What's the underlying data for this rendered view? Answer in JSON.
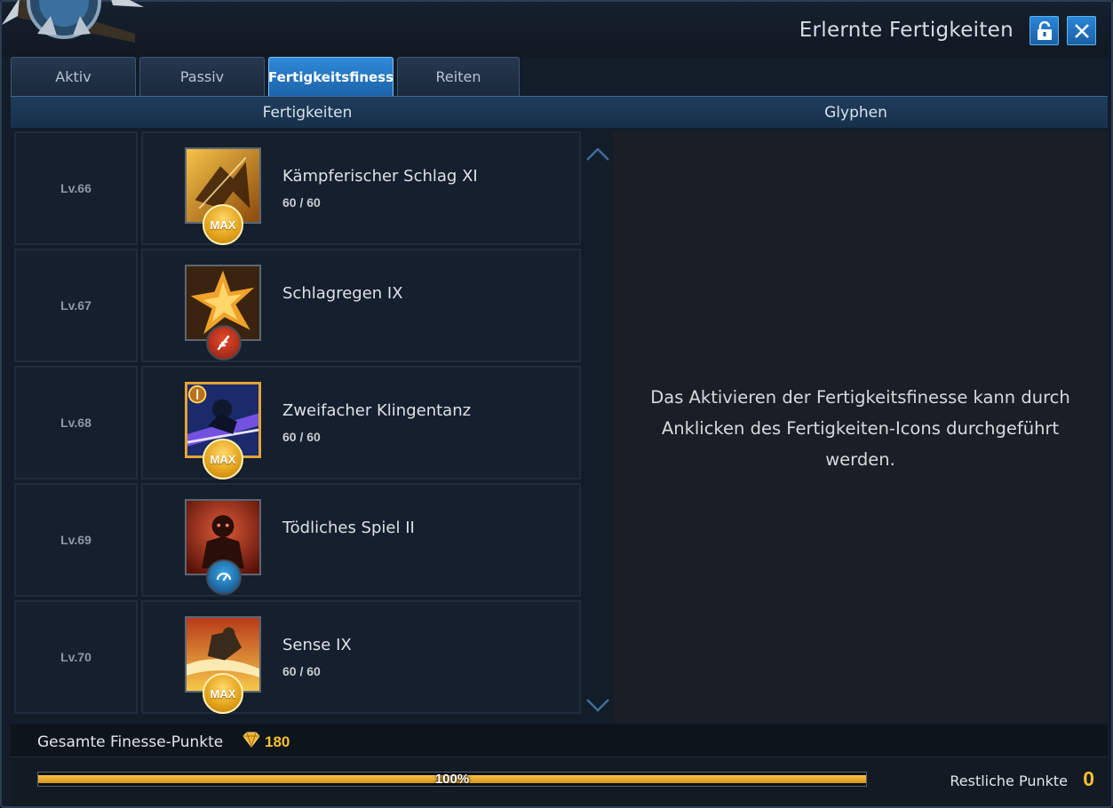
{
  "window": {
    "title": "Erlernte Fertigkeiten",
    "lock_icon": "lock-icon",
    "close_icon": "close-icon"
  },
  "tabs": [
    {
      "label": "Aktiv",
      "active": false
    },
    {
      "label": "Passiv",
      "active": false
    },
    {
      "label": "Fertigkeitsfiness",
      "active": true
    },
    {
      "label": "Reiten",
      "active": false
    }
  ],
  "subheader": {
    "left": "Fertigkeiten",
    "right": "Glyphen"
  },
  "skills": [
    {
      "level": "Lv.66",
      "name": "Kämpferischer Schlag XI",
      "points": "60 / 60",
      "badge": "MAX"
    },
    {
      "level": "Lv.67",
      "name": "Schlagregen IX",
      "points": "",
      "badge": "feather-icon"
    },
    {
      "level": "Lv.68",
      "name": "Zweifacher Klingentanz",
      "points": "60 / 60",
      "badge": "MAX"
    },
    {
      "level": "Lv.69",
      "name": "Tödliches Spiel II",
      "points": "",
      "badge": "speed-icon"
    },
    {
      "level": "Lv.70",
      "name": "Sense IX",
      "points": "60 / 60",
      "badge": "MAX"
    }
  ],
  "glyph_hint": "Das Aktivieren der Fertigkeitsfinesse kann durch Anklicken des Fertigkeiten-Icons durchgeführt werden.",
  "footer": {
    "total_label": "Gesamte Finesse-Punkte",
    "total_value": "180",
    "progress_label": "100%",
    "progress_fraction": 1.0,
    "remaining_label": "Restliche Punkte",
    "remaining_value": "0"
  },
  "colors": {
    "accent_blue": "#2f8ad9",
    "gold": "#f5c030"
  }
}
